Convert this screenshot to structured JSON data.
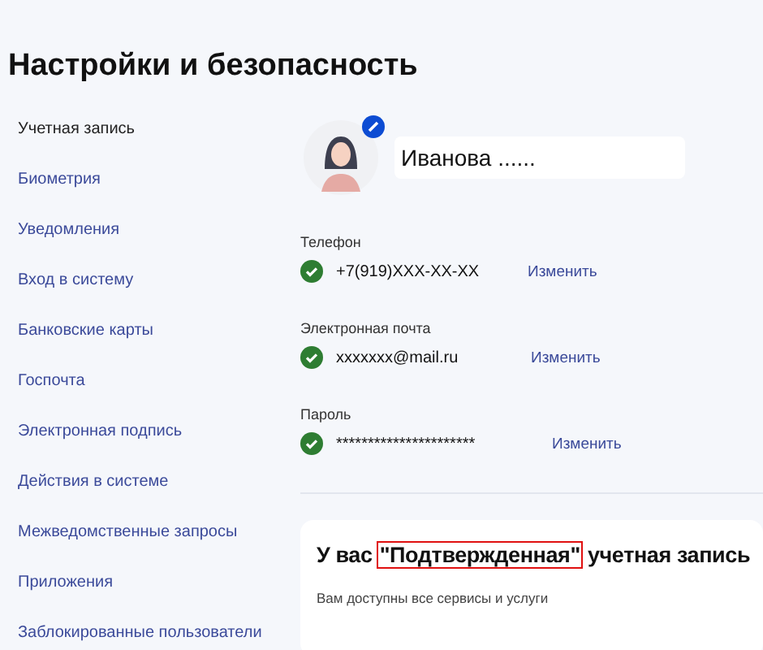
{
  "page": {
    "title": "Настройки и безопасность"
  },
  "sidebar": {
    "items": [
      {
        "label": "Учетная запись",
        "selected": true
      },
      {
        "label": "Биометрия",
        "selected": false
      },
      {
        "label": "Уведомления",
        "selected": false
      },
      {
        "label": "Вход в систему",
        "selected": false
      },
      {
        "label": "Банковские карты",
        "selected": false
      },
      {
        "label": "Госпочта",
        "selected": false
      },
      {
        "label": "Электронная подпись",
        "selected": false
      },
      {
        "label": "Действия в системе",
        "selected": false
      },
      {
        "label": "Межведомственные запросы",
        "selected": false
      },
      {
        "label": "Приложения",
        "selected": false
      },
      {
        "label": "Заблокированные пользователи",
        "selected": false
      }
    ]
  },
  "profile": {
    "name": "Иванова ......"
  },
  "fields": [
    {
      "label": "Телефон",
      "value": "+7(919)XXX-XX-XX",
      "verified": true,
      "action": "Изменить"
    },
    {
      "label": "Электронная почта",
      "value": "xxxxxxx@mail.ru",
      "verified": true,
      "action": "Изменить"
    },
    {
      "label": "Пароль",
      "value": "**********************",
      "verified": true,
      "action": "Изменить"
    }
  ],
  "status_card": {
    "heading_before": "У вас",
    "heading_highlight": "\"Подтвержденная\"",
    "heading_after": "учетная запись",
    "highlighted": true,
    "subtitle": "Вам доступны все сервисы и услуги"
  }
}
